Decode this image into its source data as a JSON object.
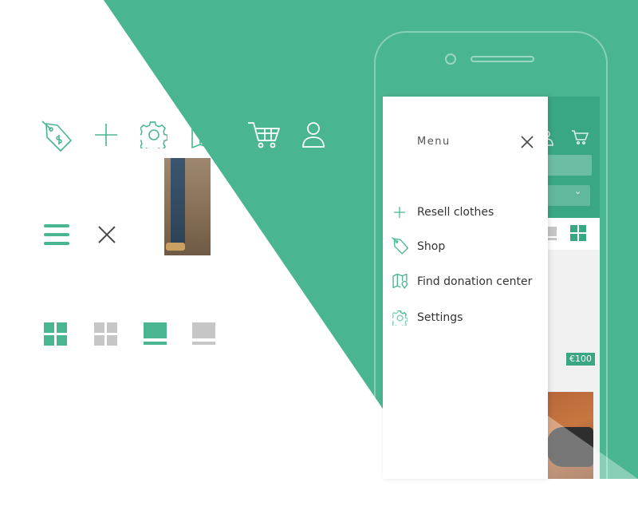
{
  "colors": {
    "brand": "#4ab591",
    "brand_dark": "#3aa784",
    "gray": "#c6c6c6",
    "dark": "#4a4a4a"
  },
  "icon_sheet": {
    "row1": [
      "price-tag-icon",
      "plus-icon",
      "gear-icon",
      "map-pin-icon",
      "cart-icon",
      "user-icon"
    ],
    "row2": [
      "hamburger-icon",
      "close-icon"
    ],
    "row3": [
      "grid-active-icon",
      "grid-inactive-icon",
      "list-active-icon",
      "list-inactive-icon"
    ]
  },
  "drawer": {
    "title": "Menu",
    "items": [
      {
        "label": "Resell clothes",
        "icon": "plus-icon"
      },
      {
        "label": "Shop",
        "icon": "price-tag-icon"
      },
      {
        "label": "Find donation center",
        "icon": "map-pin-icon"
      },
      {
        "label": "Settings",
        "icon": "gear-icon"
      }
    ]
  },
  "app": {
    "price_tag": "€100"
  }
}
